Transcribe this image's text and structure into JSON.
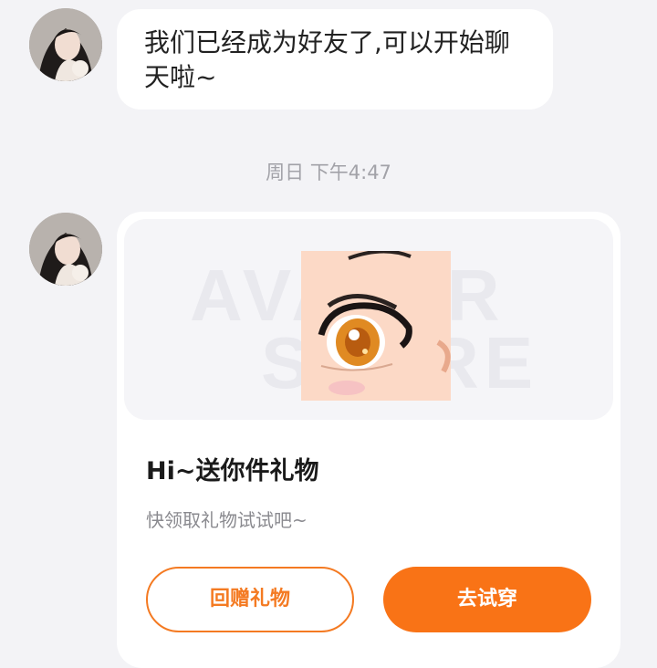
{
  "chat": {
    "message_text": "我们已经成为好友了,可以开始聊天啦~",
    "timestamp": "周日 下午4:47"
  },
  "gift_card": {
    "watermark_line1": "AVATAR",
    "watermark_line2": "STORE",
    "title": "Hi~送你件礼物",
    "subtitle": "快领取礼物试试吧~",
    "return_gift_label": "回赠礼物",
    "try_on_label": "去试穿"
  },
  "colors": {
    "accent": "#f97316",
    "background": "#f3f3f6",
    "bubble": "#ffffff"
  }
}
